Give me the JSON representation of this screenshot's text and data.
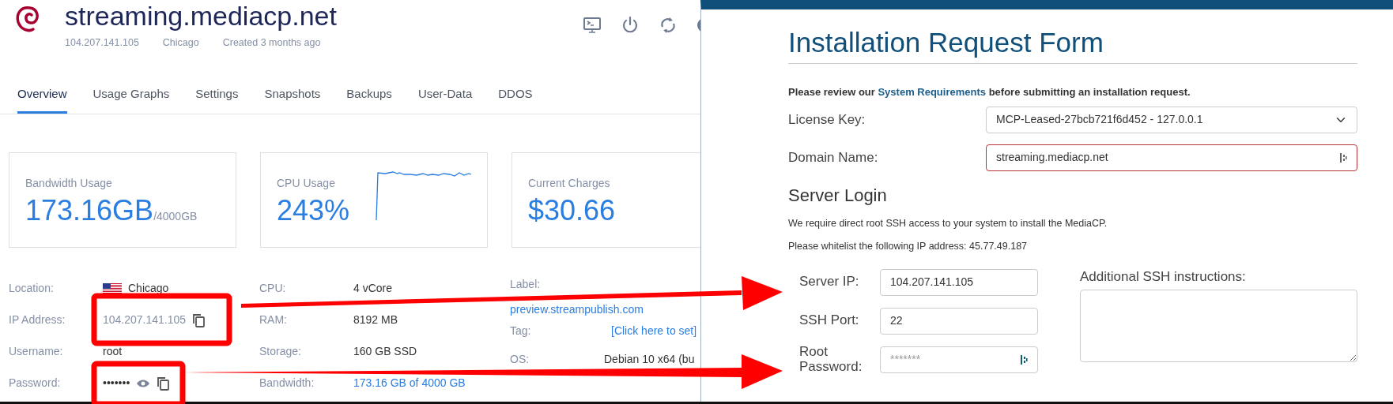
{
  "server": {
    "hostname": "streaming.mediacp.net",
    "meta": [
      "104.207.141.105",
      "Chicago",
      "Created 3 months ago"
    ]
  },
  "tabs": [
    {
      "label": "Overview",
      "selected": true
    },
    {
      "label": "Usage Graphs",
      "selected": false
    },
    {
      "label": "Settings",
      "selected": false
    },
    {
      "label": "Snapshots",
      "selected": false
    },
    {
      "label": "Backups",
      "selected": false
    },
    {
      "label": "User-Data",
      "selected": false
    },
    {
      "label": "DDOS",
      "selected": false
    }
  ],
  "stats": [
    {
      "kind": "plain",
      "title": "Bandwidth Usage",
      "value": "173.16GB",
      "suffix": "/4000GB"
    },
    {
      "kind": "sparkline",
      "title": "CPU Usage",
      "value": "243%"
    },
    {
      "kind": "plain",
      "title": "Current Charges",
      "value": "$30.66"
    }
  ],
  "details": [
    [
      {
        "kind": "flag",
        "label": "Location:",
        "value": "Chicago"
      },
      {
        "kind": "copy",
        "label": "IP Address:",
        "value": "104.207.141.105"
      },
      {
        "kind": "text",
        "label": "Username:",
        "value": "root"
      },
      {
        "kind": "secret",
        "label": "Password:",
        "value": "•••••••"
      }
    ],
    [
      {
        "kind": "text",
        "label": "CPU:",
        "value": "4 vCore"
      },
      {
        "kind": "text",
        "label": "RAM:",
        "value": "8192 MB"
      },
      {
        "kind": "text",
        "label": "Storage:",
        "value": "160 GB SSD"
      },
      {
        "kind": "link",
        "label": "Bandwidth:",
        "value": "173.16 GB of 4000 GB"
      }
    ],
    [
      {
        "kind": "below",
        "label": "Label:",
        "value": "preview.streampublish.com"
      },
      {
        "kind": "link",
        "label": "Tag:",
        "value": "[Click here to set]"
      },
      {
        "kind": "text",
        "label": "OS:",
        "value": "Debian 10 x64 (bu"
      }
    ]
  ],
  "form": {
    "title": "Installation Request Form",
    "notice": {
      "before": "Please review our ",
      "link": "System Requirements",
      "after": " before submitting an installation request."
    },
    "license_key": {
      "label": "License Key:",
      "value": "MCP-Leased-27bcb721f6d452 - 127.0.0.1"
    },
    "domain_name": {
      "label": "Domain Name:",
      "value": "streaming.mediacp.net",
      "invalid": true
    },
    "login_heading": "Server Login",
    "paragraphs": [
      "We require direct root SSH access to your system to install the MediaCP.",
      "Please whitelist the following IP address: 45.77.49.187"
    ],
    "login_fields": [
      {
        "label": "Server IP:",
        "value": "104.207.141.105"
      },
      {
        "label": "SSH Port:",
        "value": "22"
      },
      {
        "label": "Root Password:",
        "placeholder": "*******"
      }
    ],
    "instructions_label": "Additional SSH instructions:"
  }
}
